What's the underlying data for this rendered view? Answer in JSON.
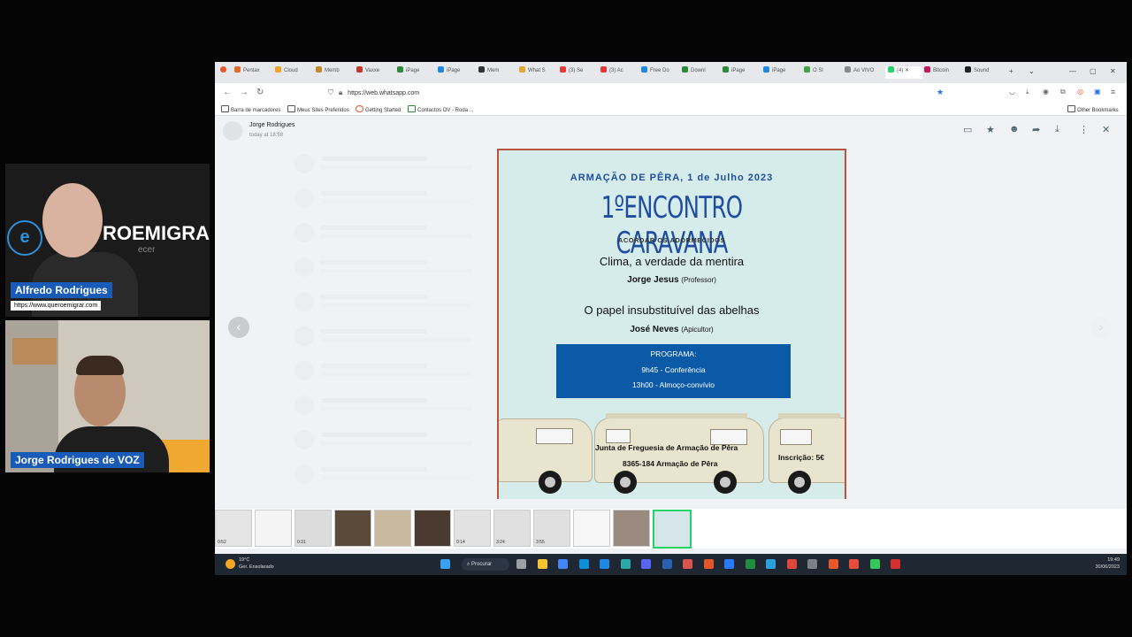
{
  "webcams": {
    "host": {
      "name": "Alfredo Rodrigues",
      "url": "https://www.queroemigrar.com",
      "logo_letter": "e",
      "logo_text": "ROEMIGRAR",
      "logo_sub": "ecer"
    },
    "guest": {
      "name": "Jorge Rodrigues de VOZ"
    }
  },
  "browser": {
    "tabs": [
      {
        "label": "Pentax",
        "color": "#e06b2e"
      },
      {
        "label": "Cloud",
        "color": "#f4a12a"
      },
      {
        "label": "Memb",
        "color": "#c08a2a"
      },
      {
        "label": "Vaxxe",
        "color": "#c0392b"
      },
      {
        "label": "iPage",
        "color": "#2a8a3a"
      },
      {
        "label": "iPage",
        "color": "#1e88e5"
      },
      {
        "label": "Mem",
        "color": "#333333"
      },
      {
        "label": "What S",
        "color": "#e0a82e"
      },
      {
        "label": "(3) Se",
        "color": "#e53935"
      },
      {
        "label": "(3) Ac",
        "color": "#e53935"
      },
      {
        "label": "Free Do",
        "color": "#1e88e5"
      },
      {
        "label": "Downl",
        "color": "#2a8a3a"
      },
      {
        "label": "iPage",
        "color": "#2a8a3a"
      },
      {
        "label": "iPage",
        "color": "#1e88e5"
      },
      {
        "label": "O Sl",
        "color": "#43a047"
      },
      {
        "label": "Ao VIVO",
        "color": "#888888"
      },
      {
        "label": "(4)",
        "color": "#25d366",
        "active": true
      },
      {
        "label": "Bitcoin",
        "color": "#c2185b"
      },
      {
        "label": "Sound",
        "color": "#222222"
      }
    ],
    "url": "https://web.whatsapp.com",
    "bookmarks": [
      "Barra de marcadores",
      "Meus Sites Preferidos",
      "Getting Started",
      "Contactos OV - Roda ...",
      "Other Bookmarks"
    ]
  },
  "viewer": {
    "sender_name": "Jorge Rodrigues",
    "sender_time": "today at 18:58",
    "actions": [
      "reply-icon",
      "star-icon",
      "emoji-icon",
      "forward-icon",
      "download-icon",
      "menu-icon",
      "close-icon"
    ]
  },
  "poster": {
    "date": "ARMAÇÃO DE PÊRA, 1 de Julho 2023",
    "title": "1ºENCONTRO CARAVANA",
    "subtitle": "ACORDAR OS ADORMECIDOS",
    "talk1": "Clima, a verdade da mentira",
    "speaker1": "Jorge Jesus",
    "speaker1_role": "(Professor)",
    "talk2": "O papel insubstituível das abelhas",
    "speaker2": "José Neves",
    "speaker2_role": "(Apicultor)",
    "program_title": "PROGRAMA:",
    "program_1": "9h45 - Conferência",
    "program_2": "13h00 - Almoço-convívio",
    "footer_1": "Junta de Freguesia de Armação de Pêra",
    "footer_2": "8365-184 Armação de Pêra",
    "fee": "Inscrição: 5€"
  },
  "thumbnails": [
    {
      "duration": "0:52"
    },
    {
      "duration": ""
    },
    {
      "duration": "0:31"
    },
    {
      "duration": ""
    },
    {
      "duration": ""
    },
    {
      "duration": ""
    },
    {
      "duration": "0:14"
    },
    {
      "duration": "3:24"
    },
    {
      "duration": "3:55"
    },
    {
      "duration": ""
    },
    {
      "duration": ""
    },
    {
      "duration": ""
    }
  ],
  "taskbar": {
    "temperature": "19°C",
    "weather": "Ger. Ensolarado",
    "search_label": "Procurar",
    "time": "19:49",
    "date": "30/06/2023"
  }
}
